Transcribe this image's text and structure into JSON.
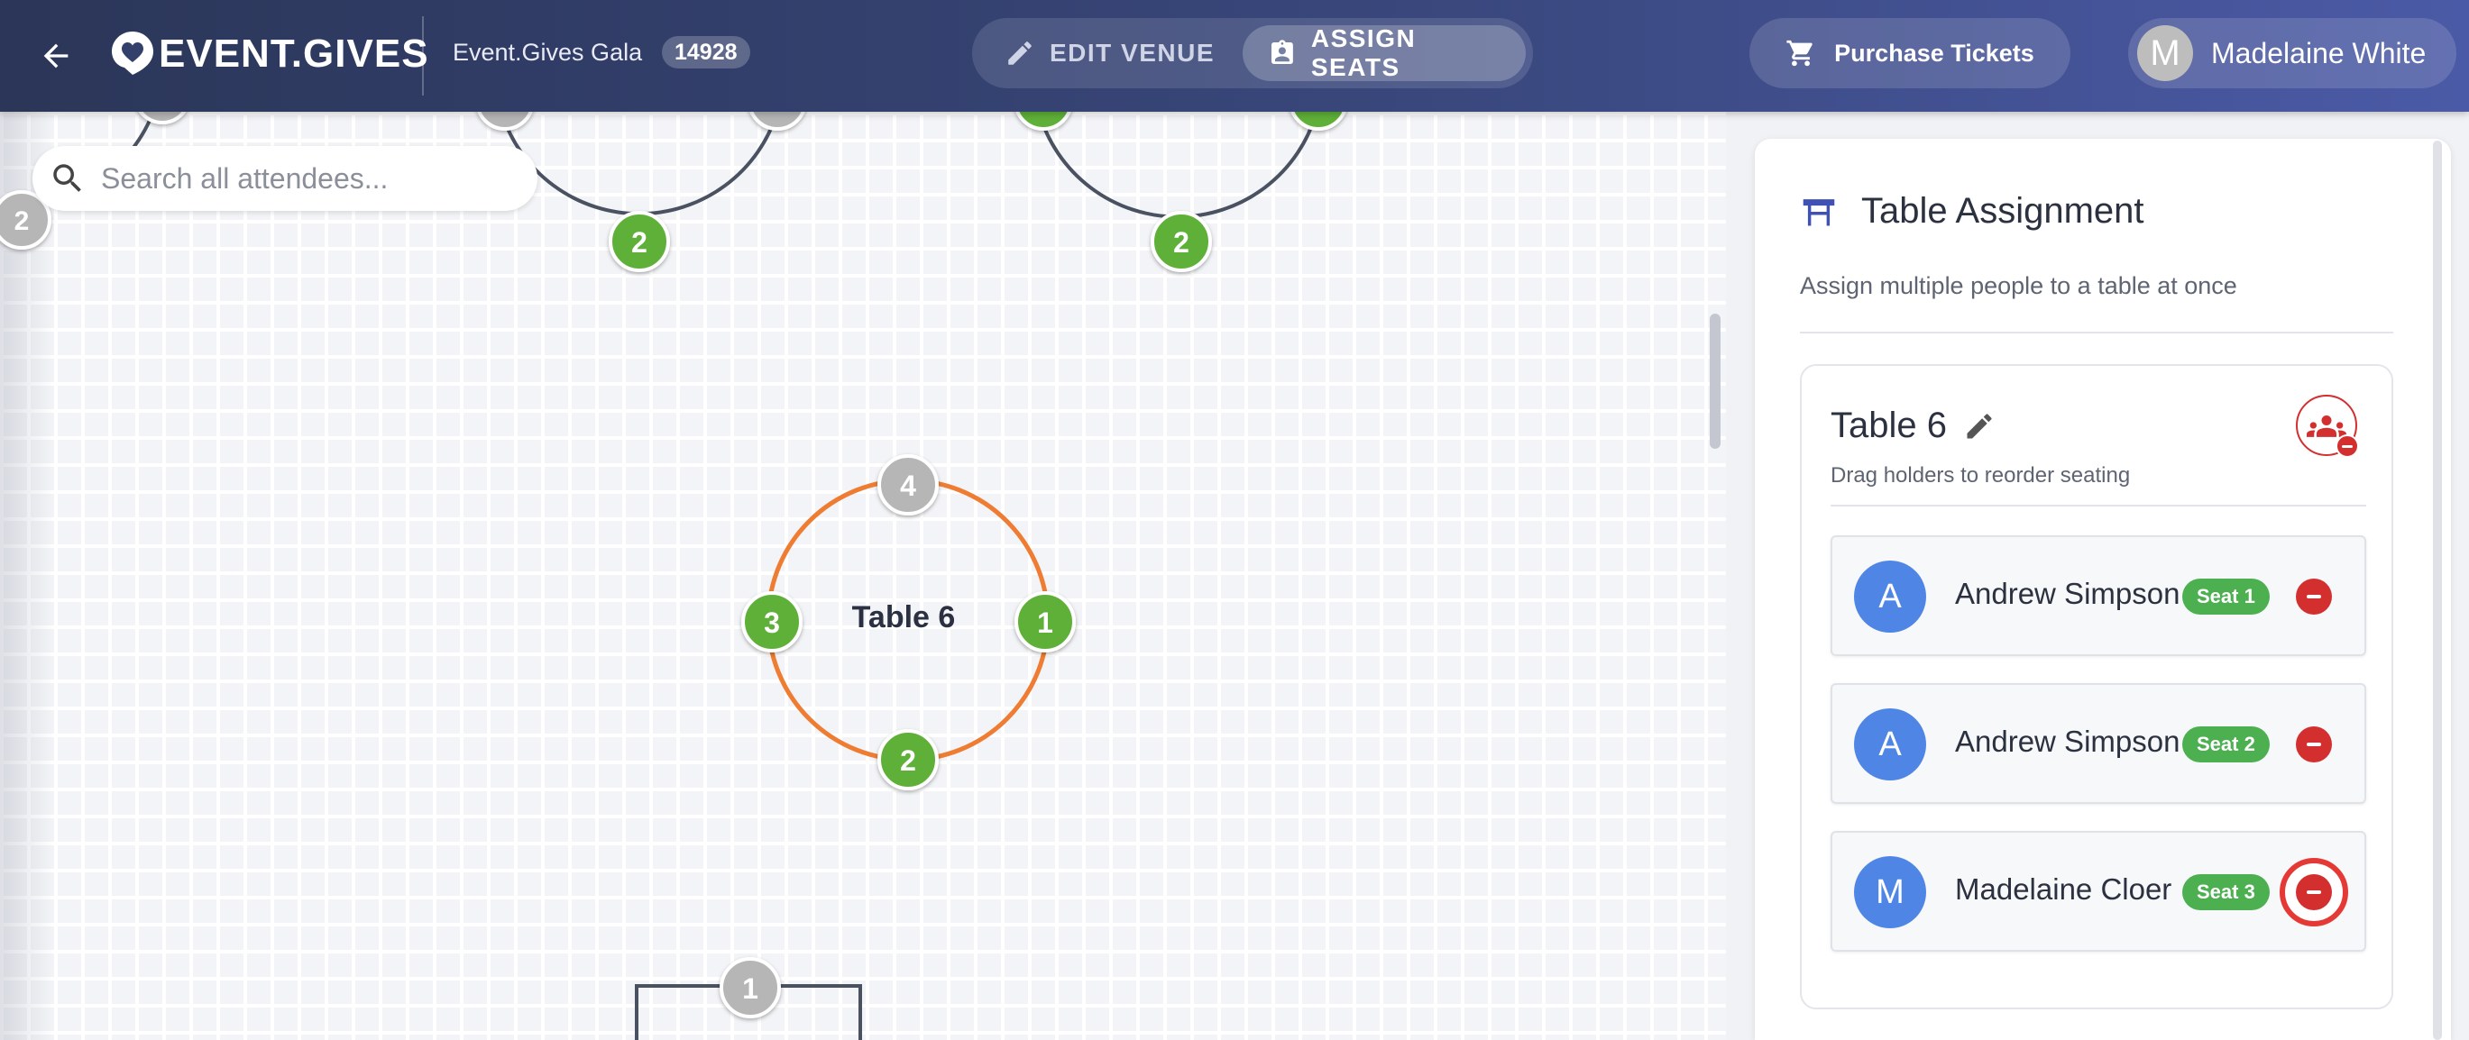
{
  "header": {
    "back_icon": "arrow-left-icon",
    "logo_text": "EVENT.GIVES",
    "event_name": "Event.Gives Gala",
    "event_id": "14928",
    "modes": [
      {
        "label": "EDIT VENUE",
        "icon": "pencil-icon",
        "active": false
      },
      {
        "label": "ASSIGN SEATS",
        "icon": "assignment-ind-icon",
        "active": true
      }
    ],
    "purchase_label": "Purchase Tickets",
    "user": {
      "initial": "M",
      "name": "Madelaine White"
    }
  },
  "search": {
    "placeholder": "Search all attendees..."
  },
  "canvas": {
    "active_table": {
      "label": "Table 6",
      "seats": [
        {
          "number": "1",
          "status": "assigned"
        },
        {
          "number": "2",
          "status": "assigned"
        },
        {
          "number": "3",
          "status": "assigned"
        },
        {
          "number": "4",
          "status": "empty"
        }
      ]
    },
    "partial_seat_labels": {
      "left_edge": "2",
      "table_a_bottom": "2",
      "table_b_bottom": "2",
      "rect_table_top": "1"
    },
    "colors": {
      "assigned": "#5fb037",
      "empty": "#b6b6b6",
      "active_ring": "#ee7d33",
      "ring": "#4a5262"
    }
  },
  "panel": {
    "title": "Table Assignment",
    "subtitle": "Assign multiple people to a table at once",
    "card": {
      "title": "Table 6",
      "hint": "Drag holders to reorder seating",
      "holders": [
        {
          "initial": "A",
          "name": "Andrew Simpson",
          "seat": "Seat 1"
        },
        {
          "initial": "A",
          "name": "Andrew Simpson",
          "seat": "Seat 2"
        },
        {
          "initial": "M",
          "name": "Madelaine Cloer",
          "seat": "Seat 3"
        }
      ]
    }
  }
}
